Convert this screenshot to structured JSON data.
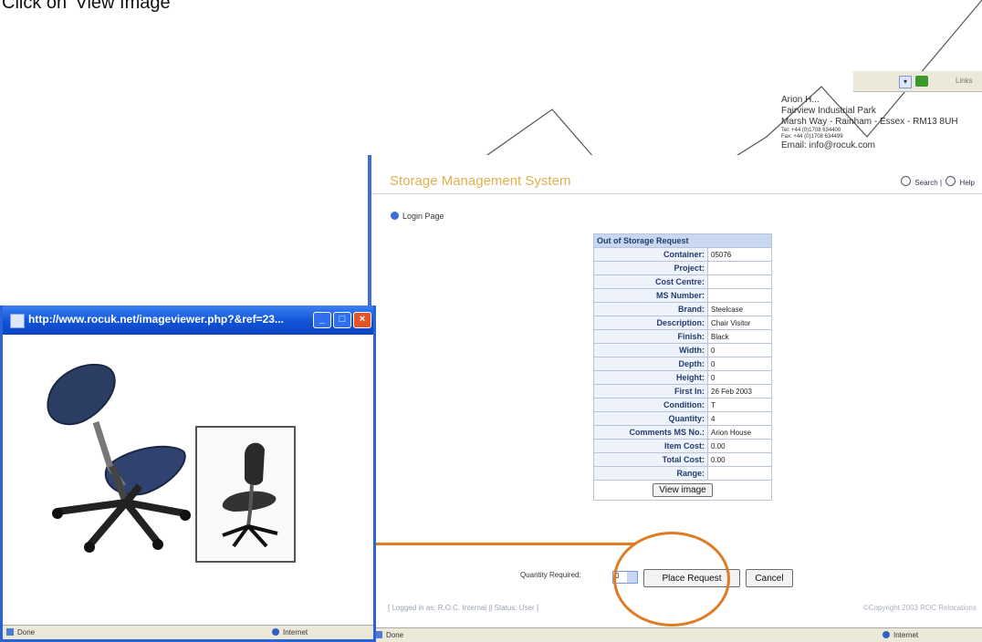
{
  "caption": "Click on 'View Image'",
  "header": {
    "company_lines": [
      "Arion H...",
      "Fairview Industrial Park",
      "Marsh Way - Rainham - Essex - RM13 8UH"
    ],
    "tel": "Tel: +44 (0)1708 634400",
    "fax": "Fax: +44 (0)1708 634499",
    "email": "Email: info@rocuk.com",
    "links_label": "Links",
    "system_title": "Storage Management System",
    "search_label": "Search",
    "help_label": "Help"
  },
  "nav": {
    "login_page": "Login Page"
  },
  "request": {
    "title": "Out of Storage Request",
    "rows": [
      {
        "label": "Container:",
        "value": "05076"
      },
      {
        "label": "Project:",
        "value": ""
      },
      {
        "label": "Cost Centre:",
        "value": ""
      },
      {
        "label": "MS Number:",
        "value": ""
      },
      {
        "label": "Brand:",
        "value": "Steelcase"
      },
      {
        "label": "Description:",
        "value": "Chair Visitor"
      },
      {
        "label": "Finish:",
        "value": "Black"
      },
      {
        "label": "Width:",
        "value": "0"
      },
      {
        "label": "Depth:",
        "value": "0"
      },
      {
        "label": "Height:",
        "value": "0"
      },
      {
        "label": "First In:",
        "value": "26 Feb 2003"
      },
      {
        "label": "Condition:",
        "value": "T"
      },
      {
        "label": "Quantity:",
        "value": "4"
      },
      {
        "label": "Comments MS No.:",
        "value": "Arion House"
      },
      {
        "label": "Item Cost:",
        "value": "0.00"
      },
      {
        "label": "Total Cost:",
        "value": "0.00"
      },
      {
        "label": "Range:",
        "value": ""
      }
    ],
    "view_image_label": "View image",
    "quantity_required_label": "Quantity Required:",
    "quantity_required_value": "0",
    "place_request_label": "Place Request",
    "cancel_label": "Cancel"
  },
  "footer": {
    "left": "[ Logged in as: R.O.C. Internal || Status: User ]",
    "right": "©Copyright 2003 ROC Relocations"
  },
  "status_bar": {
    "done": "Done",
    "zone": "Internet"
  },
  "popup": {
    "title": "http://www.rocuk.net/imageviewer.php?&ref=23...",
    "status_done": "Done",
    "status_zone": "Internet"
  },
  "colors": {
    "accent_orange": "#e07b25",
    "xp_blue": "#2a63d8",
    "system_title": "#e2b04d"
  }
}
